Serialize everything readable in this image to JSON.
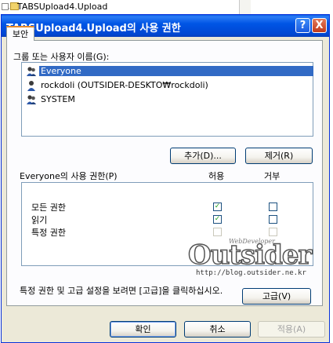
{
  "background": {
    "tree_item": "TABSUpload4.Upload"
  },
  "dialog": {
    "title": "TABSUpload4.Upload의 사용 권한",
    "help_glyph": "?",
    "close_glyph": "X",
    "tab_label": "보안",
    "users_label": "그룹 또는 사용자 이름(G):",
    "users": [
      {
        "name": "Everyone",
        "icon": "group-icon",
        "selected": true
      },
      {
        "name": "rockdoli (OUTSIDER-DESKTO₩rockdoli)",
        "icon": "user-icon",
        "selected": false
      },
      {
        "name": "SYSTEM",
        "icon": "group-icon",
        "selected": false
      }
    ],
    "add_button": "추가(D)...",
    "remove_button": "제거(R)",
    "permissions_label": "Everyone의 사용 권한(P)",
    "allow_header": "허용",
    "deny_header": "거부",
    "permissions": [
      {
        "name": "모든 권한",
        "allow": true,
        "deny": false,
        "enabled": true
      },
      {
        "name": "읽기",
        "allow": true,
        "deny": false,
        "enabled": true
      },
      {
        "name": "특정 권한",
        "allow": false,
        "deny": false,
        "enabled": false
      }
    ],
    "advanced_text": "특정 권한 및 고급 설정을 보려면 [고급]을 클릭하십시오.",
    "advanced_button": "고급(V)",
    "ok_button": "확인",
    "cancel_button": "취소",
    "apply_button": "적용(A)"
  },
  "watermark": {
    "brand": "Outsider",
    "tagline": "WebDeveloper",
    "url": "http://blog.outsider.ne.kr"
  },
  "colors": {
    "titlebar": "#0055e5",
    "selection": "#316ac5",
    "dialog_face": "#ece9d8",
    "check": "#21a121"
  }
}
